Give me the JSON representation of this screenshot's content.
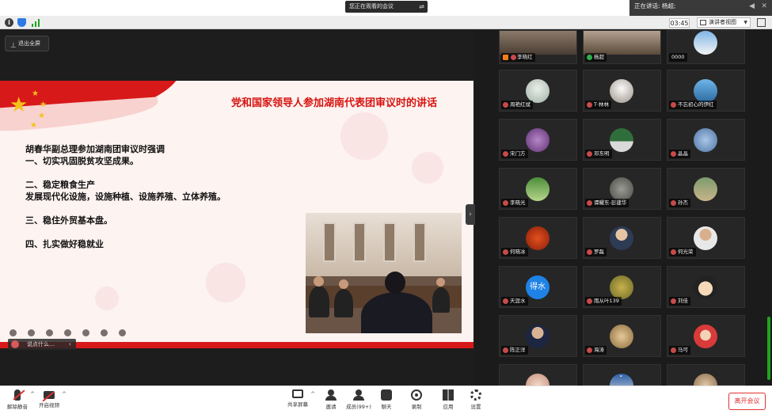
{
  "top": {
    "talking_banner": "您正在观看的会议",
    "speaking_label": "正在讲话: 杨超;"
  },
  "status": {
    "timer": "03:45",
    "view_mode": "演讲者视图"
  },
  "share": {
    "exit_fullscreen_label": "退出全屏",
    "chat_placeholder": "说点什么…",
    "slide": {
      "title": "党和国家领导人参加湖南代表团审议时的讲话",
      "lines": [
        "胡春华副总理参加湖南团审议时强调",
        "一、切实巩固脱贫攻坚成果。",
        "",
        "二、稳定粮食生产",
        "发展现代化设施，设施种植、设施养殖、立体养殖。",
        "",
        "三、稳住外贸基本盘。",
        "",
        "四、扎实做好稳就业"
      ]
    }
  },
  "participants": [
    {
      "name": "李晓红",
      "mic": "muted"
    },
    {
      "name": "杨超",
      "mic": "active"
    },
    {
      "name": "0000",
      "mic": "none"
    },
    {
      "name": "周艳红斌",
      "mic": "muted"
    },
    {
      "name": "T·林林",
      "mic": "muted"
    },
    {
      "name": "不忘初心的伊红",
      "mic": "muted"
    },
    {
      "name": "宋门方",
      "mic": "muted"
    },
    {
      "name": "邓东明",
      "mic": "muted"
    },
    {
      "name": "晶晶",
      "mic": "muted"
    },
    {
      "name": "李晓光",
      "mic": "muted"
    },
    {
      "name": "谭耀东-彭建华",
      "mic": "muted"
    },
    {
      "name": "孙杰",
      "mic": "muted"
    },
    {
      "name": "何晓冰",
      "mic": "muted"
    },
    {
      "name": "罗磊",
      "mic": "muted"
    },
    {
      "name": "何光荣",
      "mic": "muted"
    },
    {
      "name": "天涯水",
      "mic": "muted"
    },
    {
      "name": "雨从叶139",
      "mic": "muted"
    },
    {
      "name": "刘佳",
      "mic": "muted"
    },
    {
      "name": "陈正洋",
      "mic": "muted"
    },
    {
      "name": "海涛",
      "mic": "muted"
    },
    {
      "name": "马可",
      "mic": "muted"
    }
  ],
  "avatar_text": {
    "water": "得水"
  },
  "toolbar": {
    "unmute": "解除静音",
    "start_video": "开启视频",
    "share_screen": "共享屏幕",
    "invite": "邀请",
    "members": "成员(99+)",
    "chat": "聊天",
    "record": "录制",
    "apps": "应用",
    "settings": "设置",
    "leave": "离开会议"
  },
  "colors": {
    "accent_red": "#d8130f",
    "mic_green": "#2fb14b",
    "mic_red": "#c84a4a"
  }
}
